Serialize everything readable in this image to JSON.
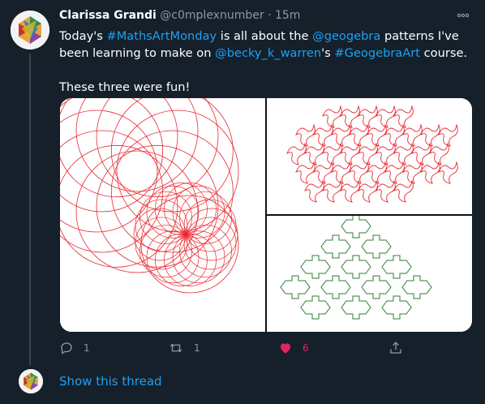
{
  "tweet": {
    "author_name": "Clarissa Grandi",
    "author_handle": "@c0mplexnumber",
    "dot": "·",
    "time": "15m",
    "more_icon": "more-icon",
    "text_parts": {
      "t1": "Today's ",
      "h1": "#MathsArtMonday",
      "t2": " is all about the ",
      "m1": "@geogebra",
      "t3": " patterns I've been learning to make on ",
      "m2": "@becky_k_warren",
      "t4": "'s ",
      "h2": "#GeogebraArt",
      "t5": " course.",
      "line2": "These three were fun!"
    },
    "media_colors": {
      "circles": "#e8272f",
      "tessellation_red": "#e8272f",
      "tessellation_green": "#2e7d32"
    }
  },
  "actions": {
    "reply": {
      "icon": "reply-icon",
      "count": "1"
    },
    "retweet": {
      "icon": "retweet-icon",
      "count": "1"
    },
    "like": {
      "icon": "heart-icon",
      "count": "6",
      "color": "#e0245e",
      "liked": true
    },
    "share": {
      "icon": "share-icon"
    }
  },
  "thread": {
    "show_label": "Show this thread"
  },
  "colors": {
    "background": "#15202b",
    "link": "#1da1f2",
    "muted": "#8899a6"
  }
}
